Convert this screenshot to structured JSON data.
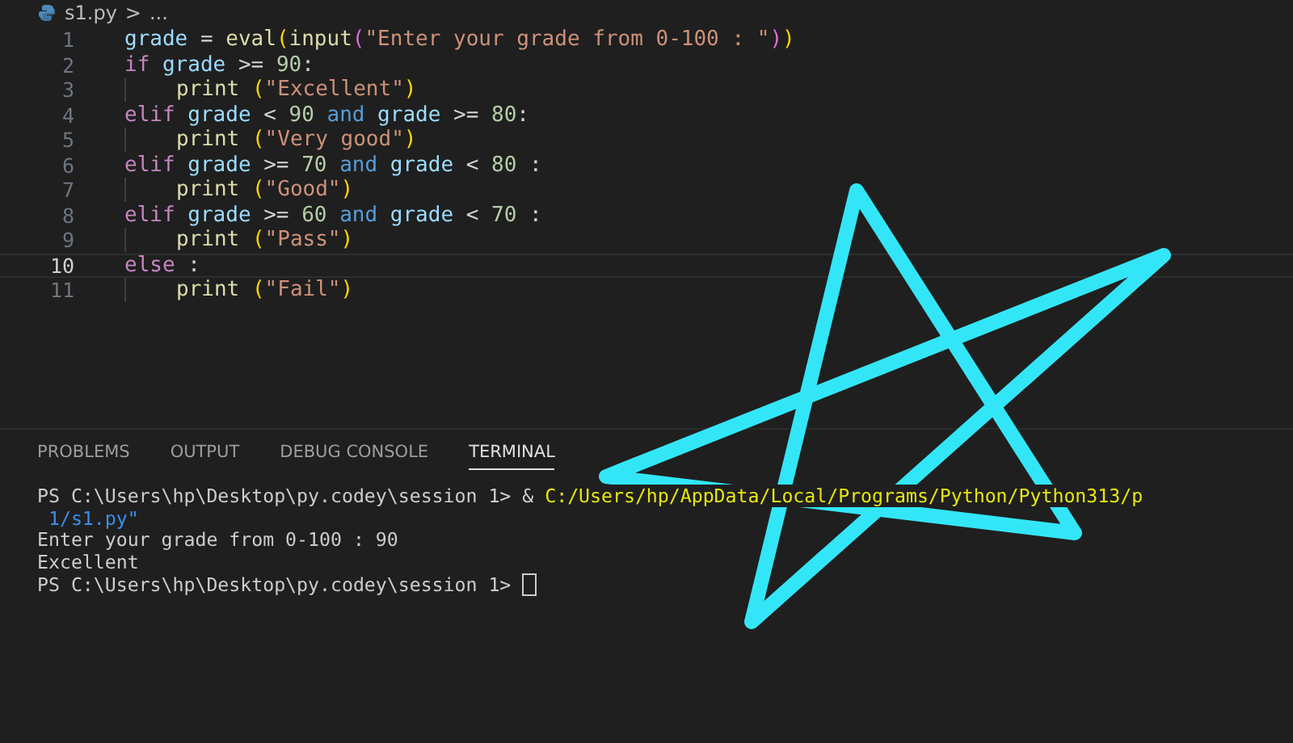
{
  "breadcrumb": {
    "file": "s1.py",
    "separator": ">",
    "rest": "..."
  },
  "editor": {
    "lines": [
      {
        "number": "1",
        "selected": false,
        "indented": false,
        "tokens": [
          {
            "kind": "var",
            "text": "grade"
          },
          {
            "kind": "op",
            "text": " = "
          },
          {
            "kind": "func",
            "text": "eval"
          },
          {
            "kind": "paren",
            "text": "("
          },
          {
            "kind": "func",
            "text": "input"
          },
          {
            "kind": "paren2",
            "text": "("
          },
          {
            "kind": "str",
            "text": "\"Enter your grade from 0-100 : \""
          },
          {
            "kind": "paren2",
            "text": ")"
          },
          {
            "kind": "paren",
            "text": ")"
          }
        ]
      },
      {
        "number": "2",
        "selected": false,
        "indented": false,
        "tokens": [
          {
            "kind": "kw",
            "text": "if"
          },
          {
            "kind": "var",
            "text": " grade"
          },
          {
            "kind": "op",
            "text": " >= "
          },
          {
            "kind": "num",
            "text": "90"
          },
          {
            "kind": "op",
            "text": ":"
          }
        ]
      },
      {
        "number": "3",
        "selected": false,
        "indented": true,
        "tokens": [
          {
            "kind": "func",
            "text": "print"
          },
          {
            "kind": "paren",
            "text": " ("
          },
          {
            "kind": "str",
            "text": "\"Excellent\""
          },
          {
            "kind": "paren",
            "text": ")"
          }
        ]
      },
      {
        "number": "4",
        "selected": false,
        "indented": false,
        "tokens": [
          {
            "kind": "kw",
            "text": "elif"
          },
          {
            "kind": "var",
            "text": " grade"
          },
          {
            "kind": "op",
            "text": " < "
          },
          {
            "kind": "num",
            "text": "90"
          },
          {
            "kind": "logic",
            "text": " and"
          },
          {
            "kind": "var",
            "text": " grade"
          },
          {
            "kind": "op",
            "text": " >= "
          },
          {
            "kind": "num",
            "text": "80"
          },
          {
            "kind": "op",
            "text": ":"
          }
        ]
      },
      {
        "number": "5",
        "selected": false,
        "indented": true,
        "tokens": [
          {
            "kind": "func",
            "text": "print"
          },
          {
            "kind": "paren",
            "text": " ("
          },
          {
            "kind": "str",
            "text": "\"Very good\""
          },
          {
            "kind": "paren",
            "text": ")"
          }
        ]
      },
      {
        "number": "6",
        "selected": false,
        "indented": false,
        "tokens": [
          {
            "kind": "kw",
            "text": "elif"
          },
          {
            "kind": "var",
            "text": " grade"
          },
          {
            "kind": "op",
            "text": " >= "
          },
          {
            "kind": "num",
            "text": "70"
          },
          {
            "kind": "logic",
            "text": " and"
          },
          {
            "kind": "var",
            "text": " grade"
          },
          {
            "kind": "op",
            "text": " < "
          },
          {
            "kind": "num",
            "text": "80"
          },
          {
            "kind": "op",
            "text": " :"
          }
        ]
      },
      {
        "number": "7",
        "selected": false,
        "indented": true,
        "tokens": [
          {
            "kind": "func",
            "text": "print"
          },
          {
            "kind": "paren",
            "text": " ("
          },
          {
            "kind": "str",
            "text": "\"Good\""
          },
          {
            "kind": "paren",
            "text": ")"
          }
        ]
      },
      {
        "number": "8",
        "selected": false,
        "indented": false,
        "tokens": [
          {
            "kind": "kw",
            "text": "elif"
          },
          {
            "kind": "var",
            "text": " grade"
          },
          {
            "kind": "op",
            "text": " >= "
          },
          {
            "kind": "num",
            "text": "60"
          },
          {
            "kind": "logic",
            "text": " and"
          },
          {
            "kind": "var",
            "text": " grade"
          },
          {
            "kind": "op",
            "text": " < "
          },
          {
            "kind": "num",
            "text": "70"
          },
          {
            "kind": "op",
            "text": " :"
          }
        ]
      },
      {
        "number": "9",
        "selected": false,
        "indented": true,
        "tokens": [
          {
            "kind": "func",
            "text": "print"
          },
          {
            "kind": "paren",
            "text": " ("
          },
          {
            "kind": "str",
            "text": "\"Pass\""
          },
          {
            "kind": "paren",
            "text": ")"
          }
        ]
      },
      {
        "number": "10",
        "selected": true,
        "indented": false,
        "tokens": [
          {
            "kind": "kw",
            "text": "else"
          },
          {
            "kind": "op",
            "text": " :"
          }
        ]
      },
      {
        "number": "11",
        "selected": false,
        "indented": true,
        "tokens": [
          {
            "kind": "func",
            "text": "print"
          },
          {
            "kind": "paren",
            "text": " ("
          },
          {
            "kind": "str",
            "text": "\"Fail\""
          },
          {
            "kind": "paren",
            "text": ")"
          }
        ]
      }
    ]
  },
  "panel_tabs": [
    {
      "label": "PROBLEMS",
      "selected": false
    },
    {
      "label": "OUTPUT",
      "selected": false
    },
    {
      "label": "DEBUG CONSOLE",
      "selected": false
    },
    {
      "label": "TERMINAL",
      "selected": true
    }
  ],
  "terminal": {
    "lines": [
      {
        "segments": [
          {
            "kind": "plain",
            "text": "PS C:\\Users\\hp\\Desktop\\py.codey\\session 1> & "
          },
          {
            "kind": "path",
            "text": "C:/Users/hp/AppData/Local/Programs/Python/Python313/p"
          }
        ]
      },
      {
        "segments": [
          {
            "kind": "arg",
            "text": " 1/s1.py\""
          }
        ]
      },
      {
        "segments": [
          {
            "kind": "plain",
            "text": "Enter your grade from 0-100 : 90"
          }
        ]
      },
      {
        "segments": [
          {
            "kind": "plain",
            "text": "Excellent"
          }
        ]
      },
      {
        "segments": [
          {
            "kind": "plain",
            "text": "PS C:\\Users\\hp\\Desktop\\py.codey\\session 1> "
          }
        ],
        "cursor": true
      }
    ]
  }
}
